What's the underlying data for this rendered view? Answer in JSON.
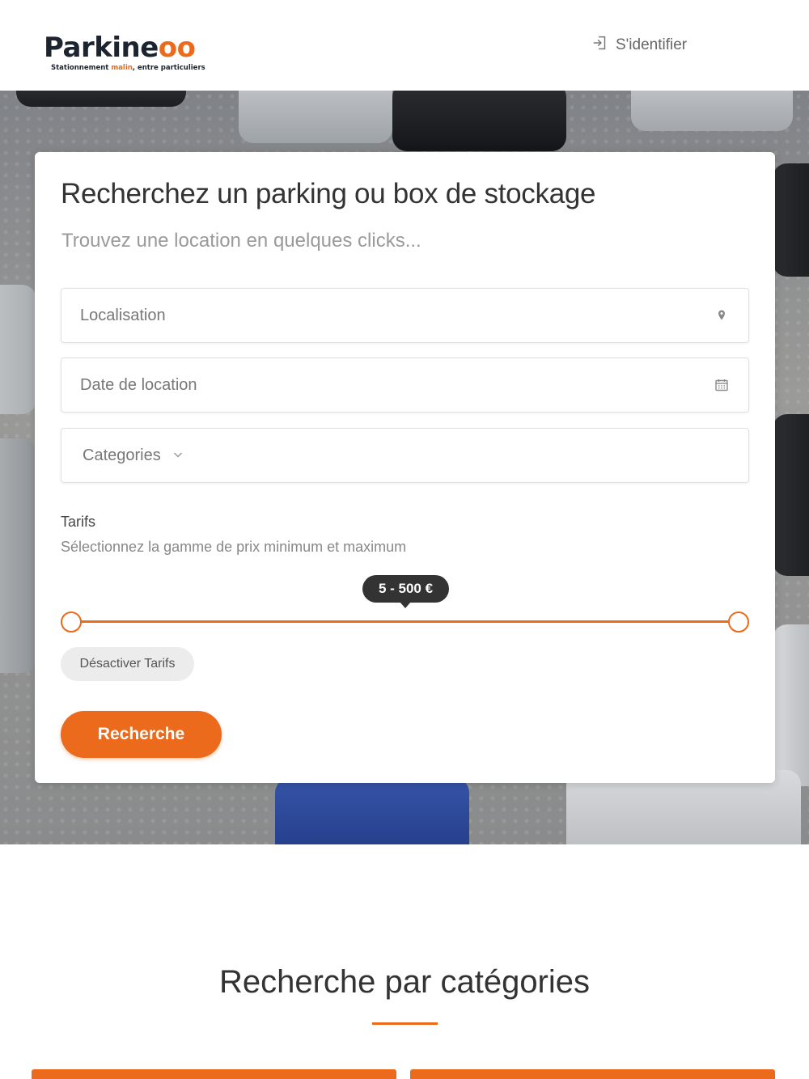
{
  "header": {
    "logo": {
      "main": "Parkine",
      "accent": "oo",
      "tagline_pre": "Stationnement ",
      "tagline_hl": "malin",
      "tagline_post": ", entre particuliers"
    },
    "signin_label": "S'identifier",
    "signin_icon": "login-icon"
  },
  "search": {
    "title": "Recherchez un parking ou box de stockage",
    "subtitle": "Trouvez une location en quelques clicks...",
    "location_placeholder": "Localisation",
    "location_icon": "map-pin-icon",
    "date_placeholder": "Date de location",
    "date_icon": "calendar-icon",
    "categories_label": "Categories",
    "categories_icon": "chevron-down-icon",
    "tarifs_label": "Tarifs",
    "tarifs_help": "Sélectionnez la gamme de prix minimum et maximum",
    "price_range": {
      "label": "5 - 500 €",
      "min": 5,
      "max": 500
    },
    "toggle_tarifs_label": "Désactiver Tarifs",
    "submit_label": "Recherche"
  },
  "categories_section": {
    "title": "Recherche par catégories"
  },
  "colors": {
    "accent": "#ec6a1b",
    "brand_dark": "#1c2430",
    "tooltip_bg": "#333333"
  }
}
